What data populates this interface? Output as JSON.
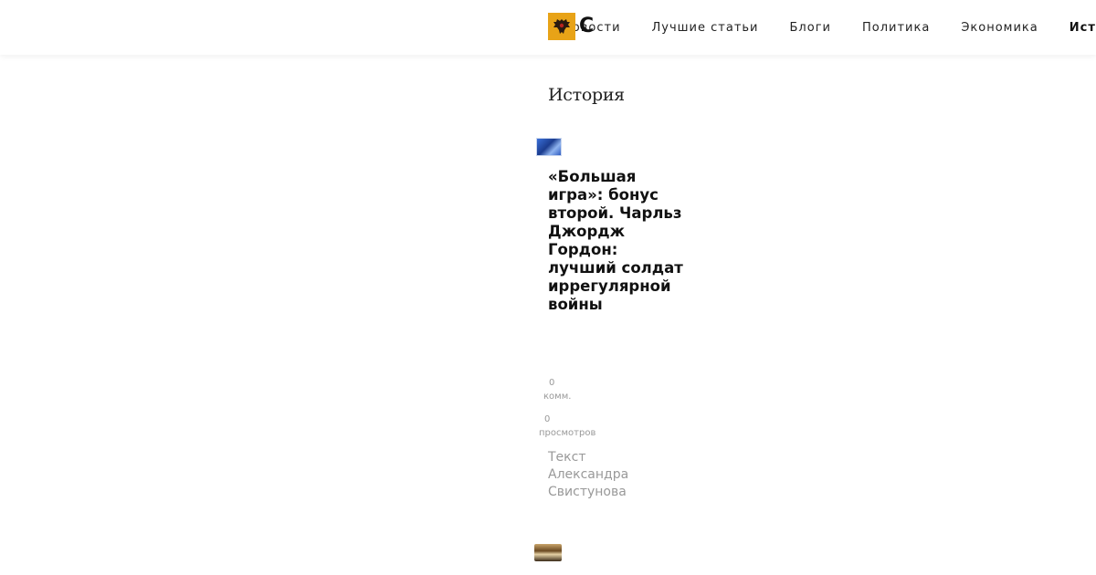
{
  "header": {
    "logo_icon": "double-headed-eagle-icon",
    "logo_letter": "С",
    "accent_color": "#e8a317",
    "nav": [
      {
        "label": "Новости",
        "active": false
      },
      {
        "label": "Лучшие статьи",
        "active": false
      },
      {
        "label": "Блоги",
        "active": false
      },
      {
        "label": "Политика",
        "active": false
      },
      {
        "label": "Экономика",
        "active": false
      },
      {
        "label": "История",
        "active": true
      }
    ]
  },
  "section": {
    "title": "История"
  },
  "article": {
    "title": "«Большая игра»: бонус второй. Чарльз Джордж Гордон: лучший солдат иррегулярной войны",
    "comments_count": "0",
    "comments_label": "комм.",
    "views_count": "0",
    "views_label": "просмотров",
    "author": "Текст Александра Свистунова"
  }
}
